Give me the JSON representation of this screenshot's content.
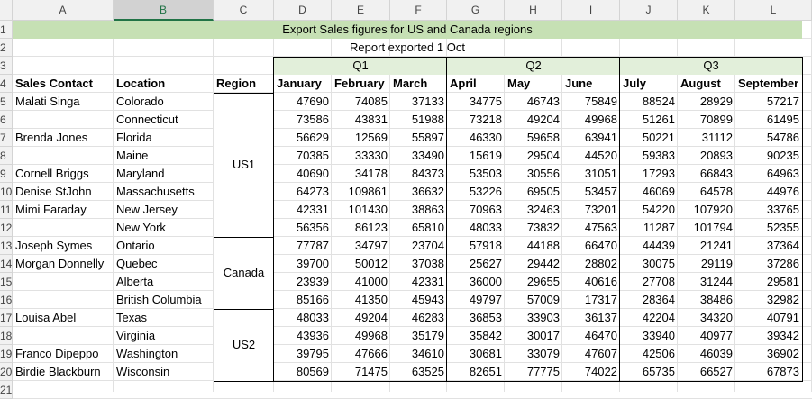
{
  "columns": [
    "A",
    "B",
    "C",
    "D",
    "E",
    "F",
    "G",
    "H",
    "I",
    "J",
    "K",
    "L"
  ],
  "selected_column": "B",
  "row_numbers": [
    "1",
    "2",
    "3",
    "4",
    "5",
    "6",
    "7",
    "8",
    "9",
    "10",
    "11",
    "12",
    "13",
    "14",
    "15",
    "16",
    "17",
    "18",
    "19",
    "20",
    "21"
  ],
  "title": "Export Sales figures for US and Canada regions",
  "subtitle": "Report exported 1 Oct",
  "quarters": [
    "Q1",
    "Q2",
    "Q3"
  ],
  "headers": {
    "contact": "Sales Contact",
    "location": "Location",
    "region": "Region",
    "months": [
      "January",
      "February",
      "March",
      "April",
      "May",
      "June",
      "July",
      "August",
      "September"
    ]
  },
  "regions": [
    "US1",
    "Canada",
    "US2"
  ],
  "rows": [
    {
      "contact": "Malati Singa",
      "location": "Colorado",
      "values": [
        47690,
        74085,
        37133,
        34775,
        46743,
        75849,
        88524,
        28929,
        57217
      ]
    },
    {
      "contact": "",
      "location": "Connecticut",
      "values": [
        73586,
        43831,
        51988,
        73218,
        49204,
        49968,
        51261,
        70899,
        61495
      ]
    },
    {
      "contact": "Brenda Jones",
      "location": "Florida",
      "values": [
        56629,
        12569,
        55897,
        46330,
        59658,
        63941,
        50221,
        31112,
        54786
      ]
    },
    {
      "contact": "",
      "location": "Maine",
      "values": [
        70385,
        33330,
        33490,
        15619,
        29504,
        44520,
        59383,
        20893,
        90235
      ]
    },
    {
      "contact": "Cornell Briggs",
      "location": "Maryland",
      "values": [
        40690,
        34178,
        84373,
        53503,
        30556,
        31051,
        17293,
        66843,
        64963
      ]
    },
    {
      "contact": "Denise StJohn",
      "location": "Massachusetts",
      "values": [
        64273,
        109861,
        36632,
        53226,
        69505,
        53457,
        46069,
        64578,
        44976
      ]
    },
    {
      "contact": "Mimi Faraday",
      "location": "New Jersey",
      "values": [
        42331,
        101430,
        38863,
        70963,
        32463,
        73201,
        54220,
        107920,
        33765
      ]
    },
    {
      "contact": "",
      "location": "New York",
      "values": [
        56356,
        86123,
        65810,
        48033,
        73832,
        47563,
        11287,
        101794,
        52355
      ]
    },
    {
      "contact": "Joseph Symes",
      "location": "Ontario",
      "values": [
        77787,
        34797,
        23704,
        57918,
        44188,
        66470,
        44439,
        21241,
        37364
      ]
    },
    {
      "contact": "Morgan Donnelly",
      "location": "Quebec",
      "values": [
        39700,
        50012,
        37038,
        25627,
        29442,
        28802,
        30075,
        29119,
        37286
      ]
    },
    {
      "contact": "",
      "location": "Alberta",
      "values": [
        23939,
        41000,
        42331,
        36000,
        29655,
        40616,
        27708,
        31244,
        29581
      ]
    },
    {
      "contact": "",
      "location": "British Columbia",
      "values": [
        85166,
        41350,
        45943,
        49797,
        57009,
        17317,
        28364,
        38486,
        32982
      ]
    },
    {
      "contact": "Louisa Abel",
      "location": "Texas",
      "values": [
        48033,
        49204,
        46283,
        36853,
        33903,
        36137,
        42204,
        34320,
        40791
      ]
    },
    {
      "contact": "",
      "location": "Virginia",
      "values": [
        43936,
        49968,
        35179,
        35842,
        30017,
        46470,
        33940,
        40977,
        39342
      ]
    },
    {
      "contact": "Franco Dipeppo",
      "location": "Washington",
      "values": [
        39795,
        47666,
        34610,
        30681,
        33079,
        47607,
        42506,
        46039,
        36902
      ]
    },
    {
      "contact": "Birdie Blackburn",
      "location": "Wisconsin",
      "values": [
        80569,
        71475,
        63525,
        82651,
        77775,
        74022,
        65735,
        66527,
        67873
      ]
    }
  ],
  "colors": {
    "title_fill": "#c6e0b4",
    "quarter_fill": "#e2efda",
    "header_bg": "#f1f1f1",
    "selected_header": "#217346"
  }
}
